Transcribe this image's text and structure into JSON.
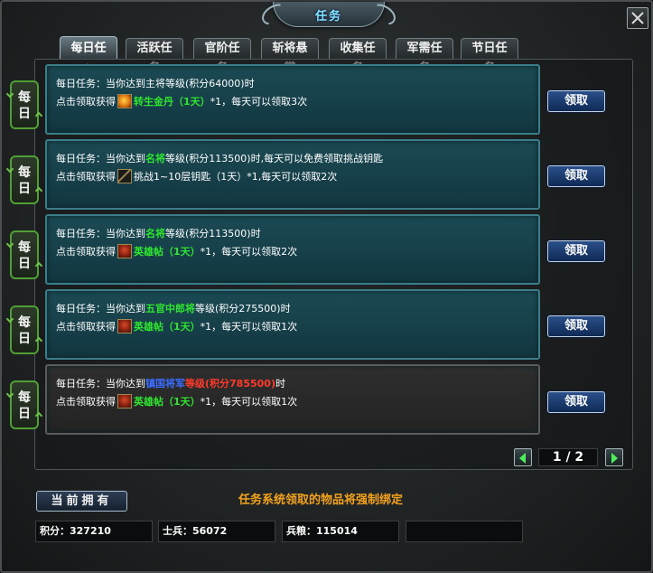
{
  "window": {
    "title": "任务"
  },
  "tabs": [
    {
      "label": "每日任务",
      "active": true
    },
    {
      "label": "活跃任务",
      "active": false
    },
    {
      "label": "官阶任务",
      "active": false
    },
    {
      "label": "斩将悬赏",
      "active": false
    },
    {
      "label": "收集任务",
      "active": false
    },
    {
      "label": "军需任务",
      "active": false
    },
    {
      "label": "节日任务",
      "active": false
    }
  ],
  "daily_tag": "每日",
  "claim_label": "领取",
  "quests": [
    {
      "l1_prefix": "每日任务：当你达到主将等级(积分64000)时",
      "l2_prefix": "点击领取获得",
      "item_icon": "golden-pill-icon",
      "item_name": "转生金丹（1天）",
      "l2_suffix": "*1，每天可以领取3次"
    },
    {
      "l1_a": "每日任务：当你达到",
      "l1_rank": "名将",
      "l1_b": "等级(积分113500)时,每天可以免费领取挑战钥匙",
      "l2_prefix": "点击领取获得",
      "item_icon": "key-icon",
      "item_name": "挑战1~10层钥匙（1天）",
      "l2_suffix": "*1,每天可以领取2次"
    },
    {
      "l1_a": "每日任务：当你达到",
      "l1_rank": "名将",
      "l1_b": "等级(积分113500)时",
      "l2_prefix": "点击领取获得",
      "item_icon": "hero-card-icon",
      "item_name": "英雄帖（1天）",
      "l2_suffix": "*1，每天可以领取2次"
    },
    {
      "l1_a": "每日任务：当你达到",
      "l1_rank": "五官中郎将",
      "l1_b": "等级(积分275500)时",
      "l2_prefix": "点击领取获得",
      "item_icon": "hero-card-icon",
      "item_name": "英雄帖（1天）",
      "l2_suffix": "*1，每天可以领取1次"
    },
    {
      "l1_a": "每日任务：当你达到",
      "l1_rank": "镇国将军",
      "l1_mid": "等级(积分785500)",
      "l1_b": "时",
      "l2_prefix": "点击领取获得",
      "item_icon": "hero-card-icon",
      "item_name": "英雄帖（1天）",
      "l2_suffix": "*1，每天可以领取1次"
    }
  ],
  "pager": {
    "text": "1 / 2"
  },
  "bottom": {
    "current_label": "当前拥有",
    "notice": "任务系统领取的物品将强制绑定",
    "points": "积分：327210",
    "soldiers": "士兵：56072",
    "grain": "兵粮：115014",
    "empty": ""
  },
  "colors": {
    "rank_green": "#2fe52f",
    "rank_blue": "#3b6cff",
    "rank_red": "#ff3a2a",
    "notice_orange": "#f2a21c",
    "title_cyan": "#7fe6ff"
  }
}
